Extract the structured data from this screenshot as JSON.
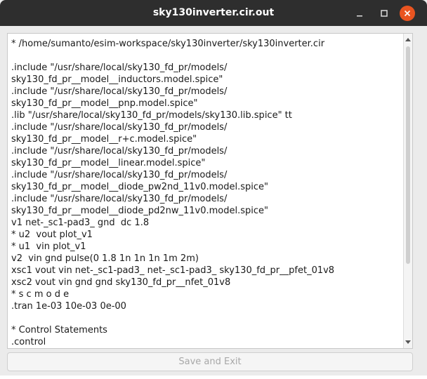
{
  "window": {
    "title": "sky130inverter.cir.out",
    "controls": {
      "minimize_icon": "minimize-icon",
      "maximize_icon": "maximize-icon",
      "close_icon": "close-icon",
      "close_color": "#e95420"
    }
  },
  "editor": {
    "lines": [
      "* /home/sumanto/esim-workspace/sky130inverter/sky130inverter.cir",
      "",
      ".include \"/usr/share/local/sky130_fd_pr/models/",
      "sky130_fd_pr__model__inductors.model.spice\"",
      ".include \"/usr/share/local/sky130_fd_pr/models/",
      "sky130_fd_pr__model__pnp.model.spice\"",
      ".lib \"/usr/share/local/sky130_fd_pr/models/sky130.lib.spice\" tt",
      ".include \"/usr/share/local/sky130_fd_pr/models/",
      "sky130_fd_pr__model__r+c.model.spice\"",
      ".include \"/usr/share/local/sky130_fd_pr/models/",
      "sky130_fd_pr__model__linear.model.spice\"",
      ".include \"/usr/share/local/sky130_fd_pr/models/",
      "sky130_fd_pr__model__diode_pw2nd_11v0.model.spice\"",
      ".include \"/usr/share/local/sky130_fd_pr/models/",
      "sky130_fd_pr__model__diode_pd2nw_11v0.model.spice\"",
      "v1 net-_sc1-pad3_ gnd  dc 1.8",
      "* u2  vout plot_v1",
      "* u1  vin plot_v1",
      "v2  vin gnd pulse(0 1.8 1n 1n 1n 1m 2m)",
      "xsc1 vout vin net-_sc1-pad3_ net-_sc1-pad3_ sky130_fd_pr__pfet_01v8",
      "xsc2 vout vin gnd gnd sky130_fd_pr__nfet_01v8",
      "* s c m o d e",
      ".tran 1e-03 10e-03 0e-00",
      "",
      "* Control Statements",
      ".control"
    ]
  },
  "footer": {
    "save_label": "Save and Exit"
  }
}
